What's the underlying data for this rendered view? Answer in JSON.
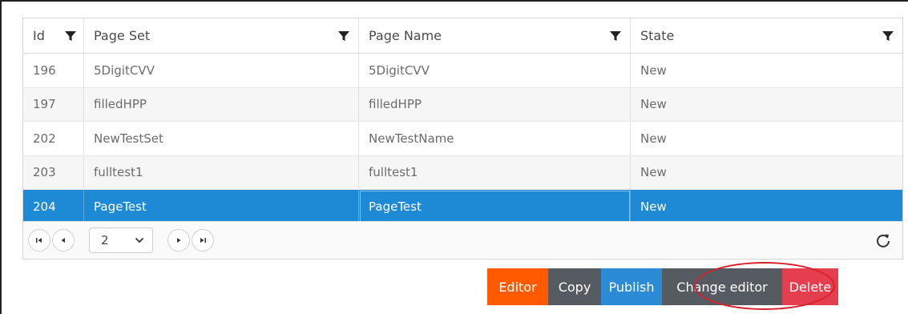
{
  "grid": {
    "columns": [
      {
        "label": "Id"
      },
      {
        "label": "Page Set"
      },
      {
        "label": "Page Name"
      },
      {
        "label": "State"
      }
    ],
    "rows": [
      {
        "id": "196",
        "page_set": "5DigitCVV",
        "page_name": "5DigitCVV",
        "state": "New"
      },
      {
        "id": "197",
        "page_set": "filledHPP",
        "page_name": "filledHPP",
        "state": "New"
      },
      {
        "id": "202",
        "page_set": "NewTestSet",
        "page_name": "NewTestName",
        "state": "New"
      },
      {
        "id": "203",
        "page_set": "fulltest1",
        "page_name": "fulltest1",
        "state": "New"
      },
      {
        "id": "204",
        "page_set": "PageTest",
        "page_name": "PageTest",
        "state": "New",
        "selected": true
      }
    ]
  },
  "pager": {
    "current_page": "2",
    "icons": [
      "first-page-icon",
      "prev-page-icon",
      "next-page-icon",
      "last-page-icon",
      "refresh-icon",
      "chevron-down-icon"
    ]
  },
  "actions": {
    "editor": "Editor",
    "copy": "Copy",
    "publish": "Publish",
    "change_editor": "Change editor",
    "delete": "Delete"
  },
  "colors": {
    "selected_row": "#1e8ad6",
    "editor": "#ff5a00",
    "copy": "#555b61",
    "publish": "#2c8bd6",
    "change_editor": "#555b61",
    "delete": "#e53f4f",
    "highlight": "#d8202a"
  }
}
